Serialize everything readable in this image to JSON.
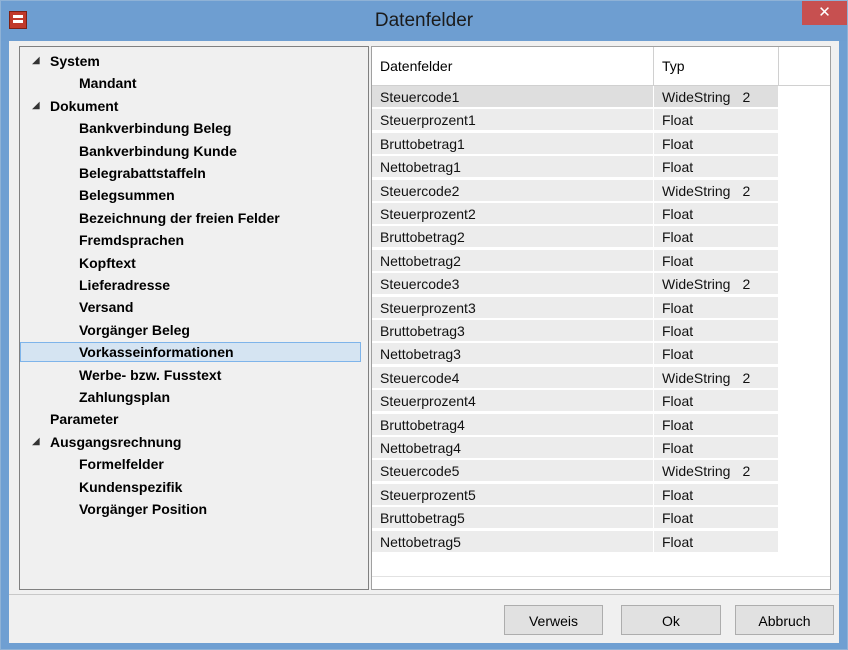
{
  "window": {
    "title": "Datenfelder",
    "close_glyph": "✕",
    "app_icon": "table-document-icon"
  },
  "tree": {
    "expander_glyph": "◢",
    "items": [
      {
        "label": "System",
        "level": 0,
        "expanded": true
      },
      {
        "label": "Mandant",
        "level": 1
      },
      {
        "label": "Dokument",
        "level": 0,
        "expanded": true
      },
      {
        "label": "Bankverbindung Beleg",
        "level": 1
      },
      {
        "label": "Bankverbindung Kunde",
        "level": 1
      },
      {
        "label": "Belegrabattstaffeln",
        "level": 1
      },
      {
        "label": "Belegsummen",
        "level": 1
      },
      {
        "label": "Bezeichnung der freien Felder",
        "level": 1
      },
      {
        "label": "Fremdsprachen",
        "level": 1
      },
      {
        "label": "Kopftext",
        "level": 1
      },
      {
        "label": "Lieferadresse",
        "level": 1
      },
      {
        "label": "Versand",
        "level": 1
      },
      {
        "label": "Vorgänger Beleg",
        "level": 1
      },
      {
        "label": "Vorkasseinformationen",
        "level": 1,
        "selected": true
      },
      {
        "label": "Werbe- bzw. Fusstext",
        "level": 1
      },
      {
        "label": "Zahlungsplan",
        "level": 1
      },
      {
        "label": "Parameter",
        "level": 0
      },
      {
        "label": "Ausgangsrechnung",
        "level": 0,
        "expanded": true
      },
      {
        "label": "Formelfelder",
        "level": 1
      },
      {
        "label": "Kundenspezifik",
        "level": 1
      },
      {
        "label": "Vorgänger Position",
        "level": 1
      }
    ]
  },
  "grid": {
    "columns": [
      "Datenfelder",
      "Typ"
    ],
    "rows": [
      {
        "name": "Steuercode1",
        "type": "WideString",
        "size": "2"
      },
      {
        "name": "Steuerprozent1",
        "type": "Float",
        "size": ""
      },
      {
        "name": "Bruttobetrag1",
        "type": "Float",
        "size": ""
      },
      {
        "name": "Nettobetrag1",
        "type": "Float",
        "size": ""
      },
      {
        "name": "Steuercode2",
        "type": "WideString",
        "size": "2"
      },
      {
        "name": "Steuerprozent2",
        "type": "Float",
        "size": ""
      },
      {
        "name": "Bruttobetrag2",
        "type": "Float",
        "size": ""
      },
      {
        "name": "Nettobetrag2",
        "type": "Float",
        "size": ""
      },
      {
        "name": "Steuercode3",
        "type": "WideString",
        "size": "2"
      },
      {
        "name": "Steuerprozent3",
        "type": "Float",
        "size": ""
      },
      {
        "name": "Bruttobetrag3",
        "type": "Float",
        "size": ""
      },
      {
        "name": "Nettobetrag3",
        "type": "Float",
        "size": ""
      },
      {
        "name": "Steuercode4",
        "type": "WideString",
        "size": "2"
      },
      {
        "name": "Steuerprozent4",
        "type": "Float",
        "size": ""
      },
      {
        "name": "Bruttobetrag4",
        "type": "Float",
        "size": ""
      },
      {
        "name": "Nettobetrag4",
        "type": "Float",
        "size": ""
      },
      {
        "name": "Steuercode5",
        "type": "WideString",
        "size": "2"
      },
      {
        "name": "Steuerprozent5",
        "type": "Float",
        "size": ""
      },
      {
        "name": "Bruttobetrag5",
        "type": "Float",
        "size": ""
      },
      {
        "name": "Nettobetrag5",
        "type": "Float",
        "size": ""
      }
    ]
  },
  "buttons": {
    "verweis": "Verweis",
    "ok": "Ok",
    "abbruch": "Abbruch"
  },
  "colors": {
    "titlebar": "#6e9ed1",
    "close": "#c75050",
    "selection": "#d5e4f2"
  }
}
